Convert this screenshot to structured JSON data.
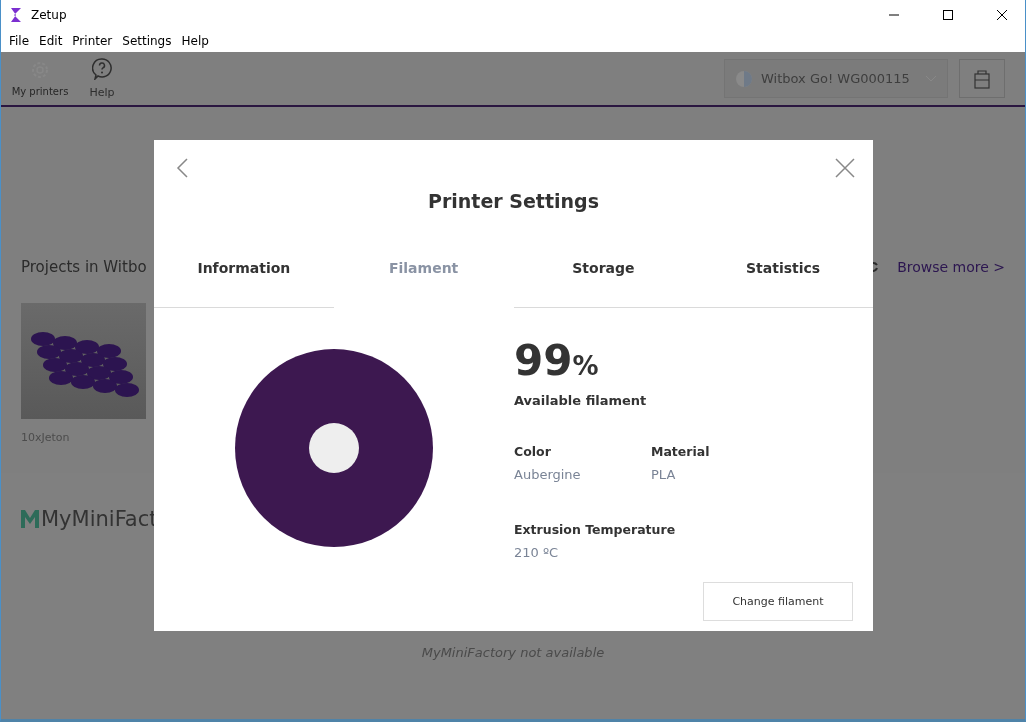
{
  "window": {
    "title": "Zetup"
  },
  "menu": [
    "File",
    "Edit",
    "Printer",
    "Settings",
    "Help"
  ],
  "toolbar": [
    {
      "kind": "gear",
      "label": "My printers",
      "disabled": true
    },
    {
      "kind": "help",
      "label": "Help",
      "disabled": false
    }
  ],
  "printer_selector": {
    "value": "Witbox Go! WG000115"
  },
  "projects": {
    "title": "Projects in Witbo",
    "link": "Browse more >",
    "items": [
      {
        "name": "10xJeton"
      }
    ]
  },
  "myminifactory": {
    "logo_text": "MyMiniFact",
    "message": "MyMiniFactory not available"
  },
  "dialog": {
    "title": "Printer Settings",
    "tabs": [
      {
        "label": "Information",
        "selected": false
      },
      {
        "label": "Filament",
        "selected": true
      },
      {
        "label": "Storage",
        "selected": false
      },
      {
        "label": "Statistics",
        "selected": false
      }
    ],
    "percent": "99",
    "percent_unit": "%",
    "percent_caption": "Available filament",
    "fields": [
      {
        "label": "Color",
        "value": "Aubergine"
      },
      {
        "label": "Material",
        "value": "PLA"
      },
      {
        "label": "Extrusion Temperature",
        "value": "210 ºC"
      }
    ],
    "button": "Change filament"
  }
}
